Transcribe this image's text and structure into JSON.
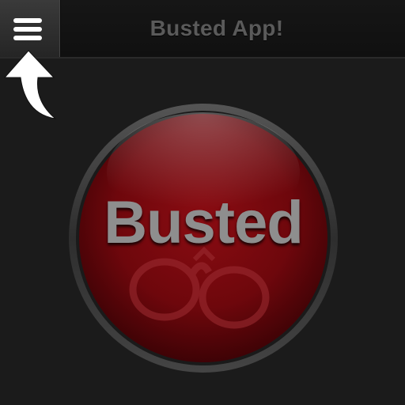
{
  "header": {
    "title": "Busted App!",
    "menu_icon": "hamburger-menu-icon"
  },
  "hint": {
    "icon": "curved-arrow-up-icon"
  },
  "main_button": {
    "label": "Busted",
    "icon": "handcuffs-icon",
    "color": "#7a0a0f"
  },
  "colors": {
    "background": "#1b1b1b",
    "navbar": "#141414",
    "title_text": "#5a5a5a",
    "button_red": "#7a0a0f"
  }
}
